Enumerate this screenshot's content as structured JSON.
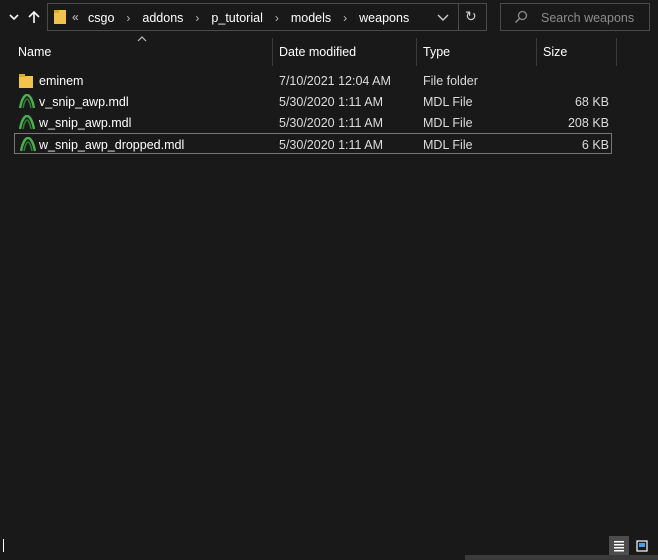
{
  "address": {
    "overflow_glyph": "«",
    "crumbs": [
      "csgo",
      "addons",
      "p_tutorial",
      "models",
      "weapons"
    ],
    "separator": "›"
  },
  "search": {
    "placeholder": "Search weapons"
  },
  "columns": {
    "name": "Name",
    "date": "Date modified",
    "type": "Type",
    "size": "Size"
  },
  "files": [
    {
      "name": "eminem",
      "date": "7/10/2021 12:04 AM",
      "type": "File folder",
      "size": "",
      "icon": "folder-icon"
    },
    {
      "name": "v_snip_awp.mdl",
      "date": "5/30/2020 1:11 AM",
      "type": "MDL File",
      "size": "68 KB",
      "icon": "mdl-file-icon"
    },
    {
      "name": "w_snip_awp.mdl",
      "date": "5/30/2020 1:11 AM",
      "type": "MDL File",
      "size": "208 KB",
      "icon": "mdl-file-icon"
    },
    {
      "name": "w_snip_awp_dropped.mdl",
      "date": "5/30/2020 1:11 AM",
      "type": "MDL File",
      "size": "6 KB",
      "icon": "mdl-file-icon",
      "selected": true
    }
  ],
  "colors": {
    "background": "#191919",
    "border": "#4a4a4a",
    "folder": "#f2c14e",
    "mdl_icon": "#4caf50"
  }
}
